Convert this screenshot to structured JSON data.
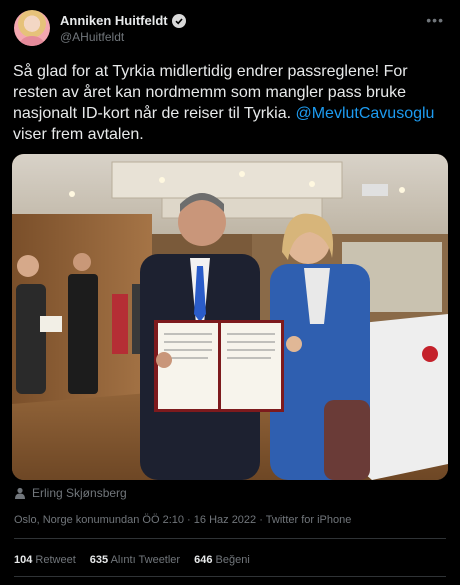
{
  "author": {
    "display_name": "Anniken Huitfeldt",
    "handle": "@AHuitfeldt"
  },
  "tweet": {
    "text": "Så glad for at Tyrkia midlertidig endrer passreglene! For resten av året kan nordmemm som mangler pass bruke nasjonalt ID-kort når de reiser til Tyrkia.",
    "mention": "@MevlutCavusoglu",
    "text_after_mention": " viser frem avtalen."
  },
  "photo_credit": "Erling Skjønsberg",
  "meta": {
    "location_time": "Oslo, Norge konumundan ÖÖ 2:10",
    "separator": "·",
    "date": "16 Haz 2022",
    "client": "Twitter for iPhone"
  },
  "stats": {
    "retweets_count": "104",
    "retweets_label": "Retweet",
    "quotes_count": "635",
    "quotes_label": "Alıntı Tweetler",
    "likes_count": "646",
    "likes_label": "Beğeni"
  },
  "colors": {
    "background": "#000000",
    "text": "#e7e9ea",
    "secondary": "#71767b",
    "link": "#1d9bf0",
    "divider": "#2f3336"
  },
  "icons": [
    "verified-badge-icon",
    "more-options-icon",
    "person-icon"
  ]
}
